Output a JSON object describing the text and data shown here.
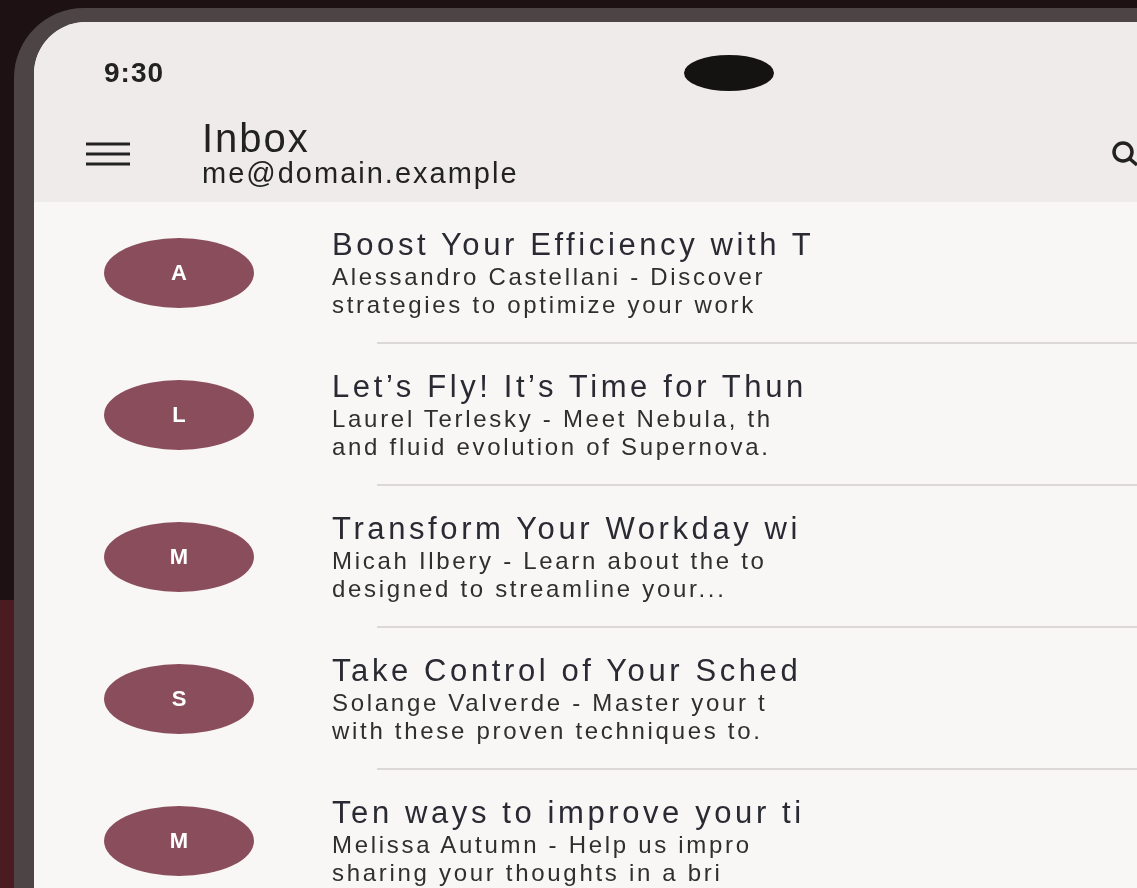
{
  "status_bar": {
    "time": "9:30"
  },
  "app_bar": {
    "title": "Inbox",
    "account": "me@domain.example"
  },
  "messages": [
    {
      "avatar": "A",
      "subject": "Boost Your Efficiency with T",
      "preview": [
        "Alessandro Castellani - Discover",
        "strategies to optimize your work"
      ]
    },
    {
      "avatar": "L",
      "subject": "Let’s Fly! It’s Time for Thun",
      "preview": [
        "Laurel Terlesky - Meet Nebula, th",
        "and fluid evolution of Supernova."
      ]
    },
    {
      "avatar": "M",
      "subject": "Transform Your Workday wi",
      "preview": [
        "Micah Ilbery - Learn about the to",
        "designed to streamline your..."
      ]
    },
    {
      "avatar": "S",
      "subject": "Take Control of Your Sched",
      "preview": [
        "Solange Valverde - Master your t",
        "with these proven techniques to."
      ]
    },
    {
      "avatar": "M",
      "subject": "Ten ways to improve your ti",
      "preview": [
        "Melissa Autumn - Help us impro",
        "sharing your thoughts in a bri"
      ]
    }
  ]
}
